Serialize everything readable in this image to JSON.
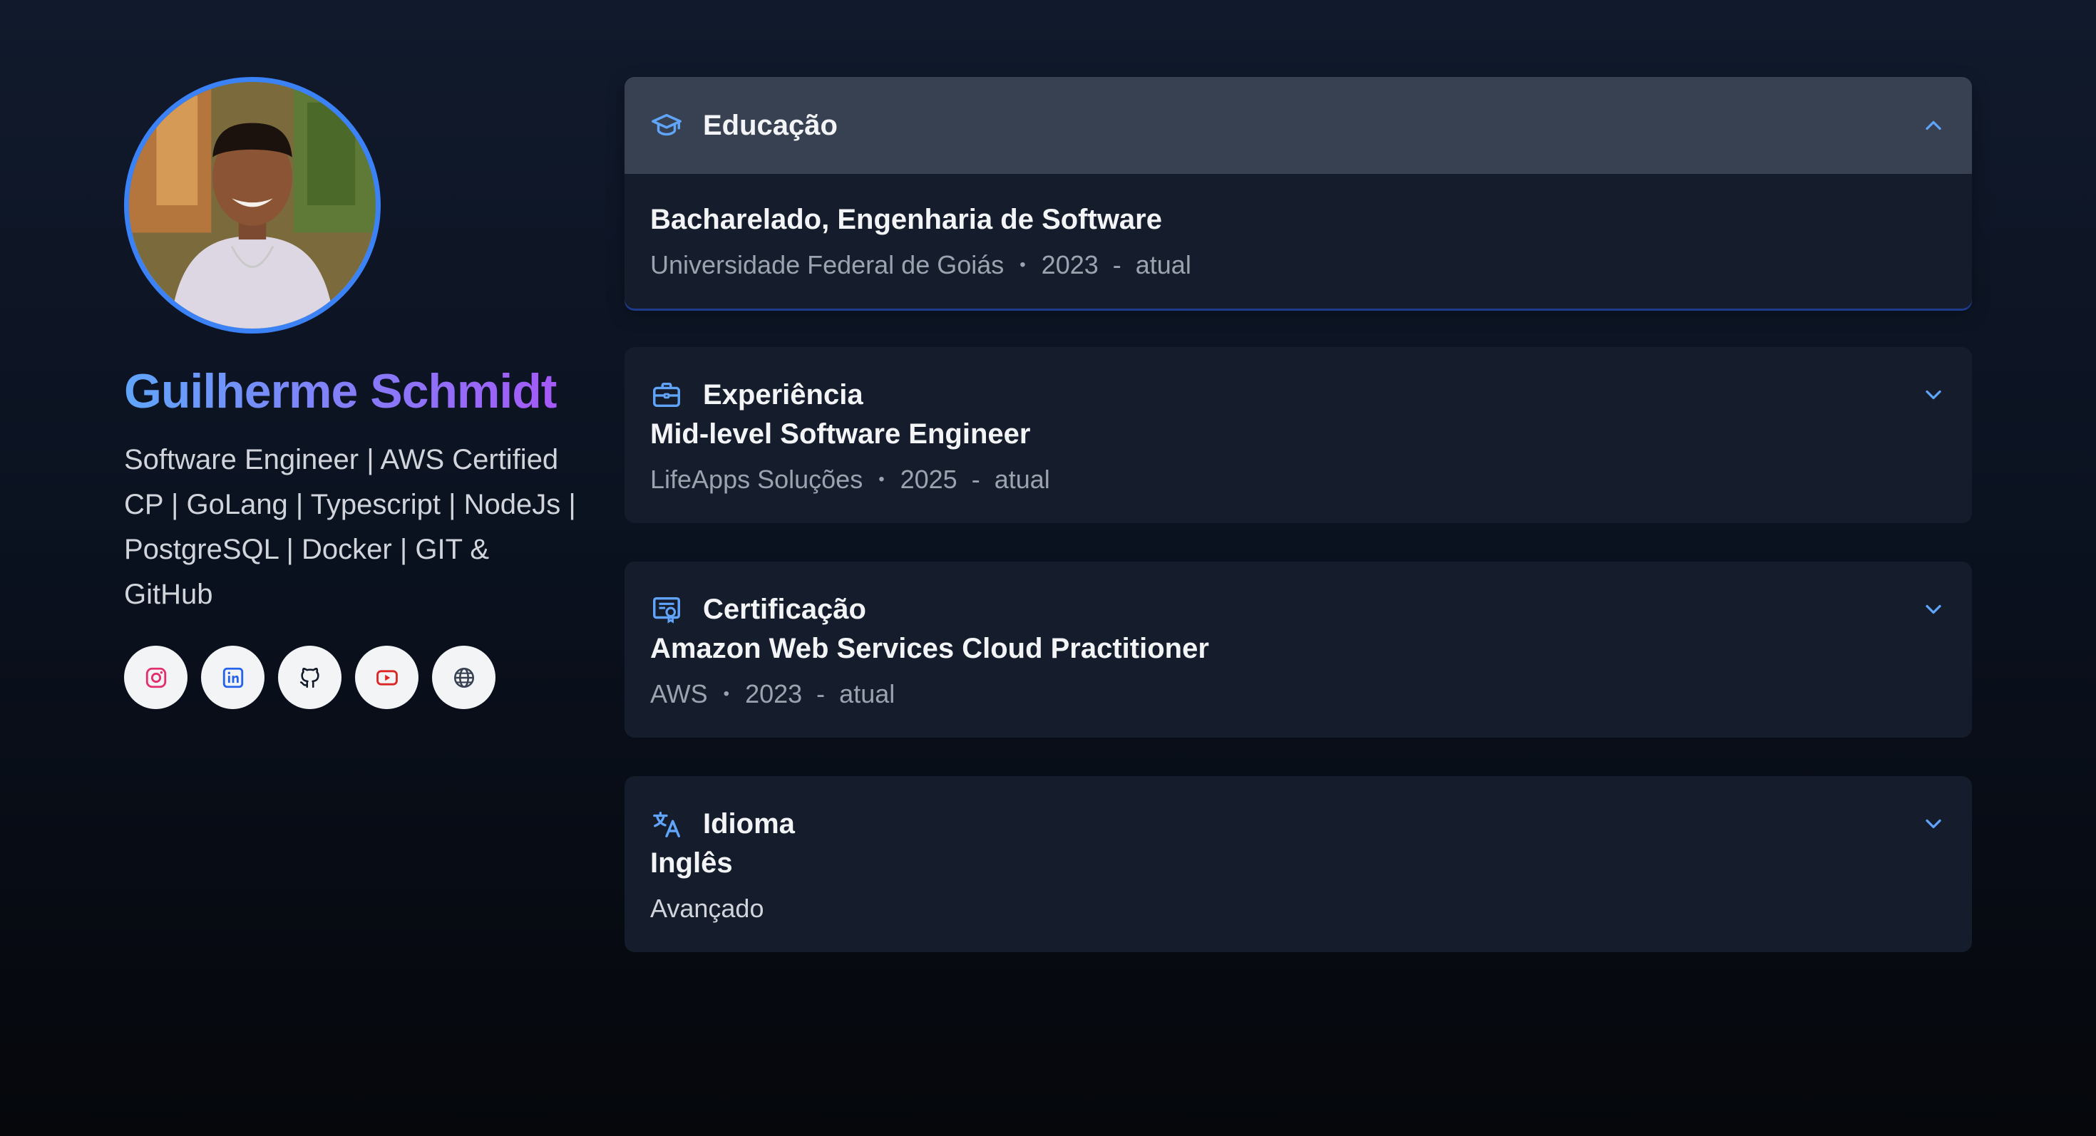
{
  "profile": {
    "name": "Guilherme Schmidt",
    "headline": "Software Engineer | AWS Certified CP | GoLang | Typescript | NodeJs | PostgreSQL | Docker | GIT & GitHub",
    "social_links": [
      {
        "icon": "instagram-icon",
        "color": "#e1306c"
      },
      {
        "icon": "linkedin-icon",
        "color": "#2563eb"
      },
      {
        "icon": "github-icon",
        "color": "#111827"
      },
      {
        "icon": "youtube-icon",
        "color": "#dc2626"
      },
      {
        "icon": "globe-icon",
        "color": "#374151"
      }
    ]
  },
  "sections": {
    "education": {
      "title": "Educação",
      "icon": "graduation-cap-icon",
      "expanded": true,
      "entry_title": "Bacharelado, Engenharia de Software",
      "org": "Universidade Federal de Goiás",
      "start": "2023",
      "end": "atual"
    },
    "experience": {
      "title": "Experiência",
      "icon": "briefcase-icon",
      "expanded": false,
      "entry_title": "Mid-level Software Engineer",
      "org": "LifeApps Soluções",
      "start": "2025",
      "end": "atual"
    },
    "certification": {
      "title": "Certificação",
      "icon": "certificate-icon",
      "expanded": false,
      "entry_title": "Amazon Web Services Cloud Practitioner",
      "org": "AWS",
      "start": "2023",
      "end": "atual"
    },
    "language": {
      "title": "Idioma",
      "icon": "translate-icon",
      "expanded": false,
      "entry_title": "Inglês",
      "level": "Avançado"
    }
  },
  "colors": {
    "accent": "#3b82f6",
    "name_gradient_start": "#60a5fa",
    "name_gradient_end": "#a855f7",
    "card_bg": "#151c2c",
    "card_header_open": "#374151"
  },
  "separators": {
    "dot": "•",
    "dash": "-"
  }
}
